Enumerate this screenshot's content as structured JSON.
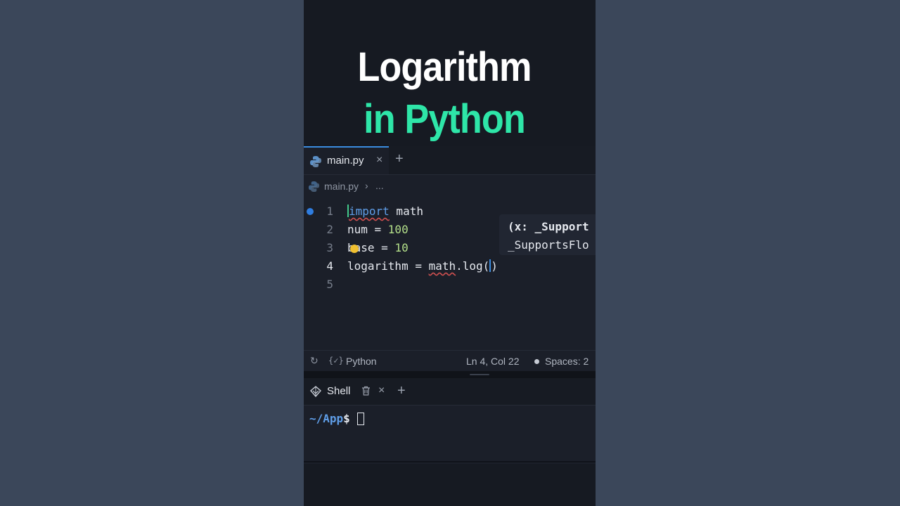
{
  "video": {
    "title_line1": "Logarithm",
    "title_line2": "in Python"
  },
  "editor": {
    "tab_label": "main.py",
    "tab_close": "×",
    "tab_add": "+",
    "breadcrumb_file": "main.py",
    "breadcrumb_sep": "›",
    "breadcrumb_more": "...",
    "lines": [
      {
        "number": "1"
      },
      {
        "number": "2",
        "text_var": "num = ",
        "text_val": "100"
      },
      {
        "number": "3",
        "text_var": "ase = ",
        "text_val": "10",
        "prefix": "b"
      },
      {
        "number": "4",
        "text_pre": "logarithm = ",
        "text_err": "math",
        "text_post": ".log(",
        "text_close": ")"
      },
      {
        "number": "5"
      }
    ],
    "line1_keyword": "import",
    "line1_rest": " math",
    "line1_first": "i",
    "hint_line1": "(x: _Support",
    "hint_line2": "_SupportsFlo"
  },
  "statusbar": {
    "sync_icon": "↻",
    "lang_icon": "{✓}",
    "language": "Python",
    "cursor_position": "Ln 4, Col 22",
    "spaces": "Spaces: 2"
  },
  "shell": {
    "tab_label": "Shell",
    "close": "×",
    "add": "+",
    "prompt_path": "~/App",
    "prompt_symbol": "$"
  },
  "colors": {
    "accent": "#3b8ce0",
    "title_green": "#2ee6a8",
    "keyword": "#5f9ee8",
    "number": "#b4e08a"
  }
}
